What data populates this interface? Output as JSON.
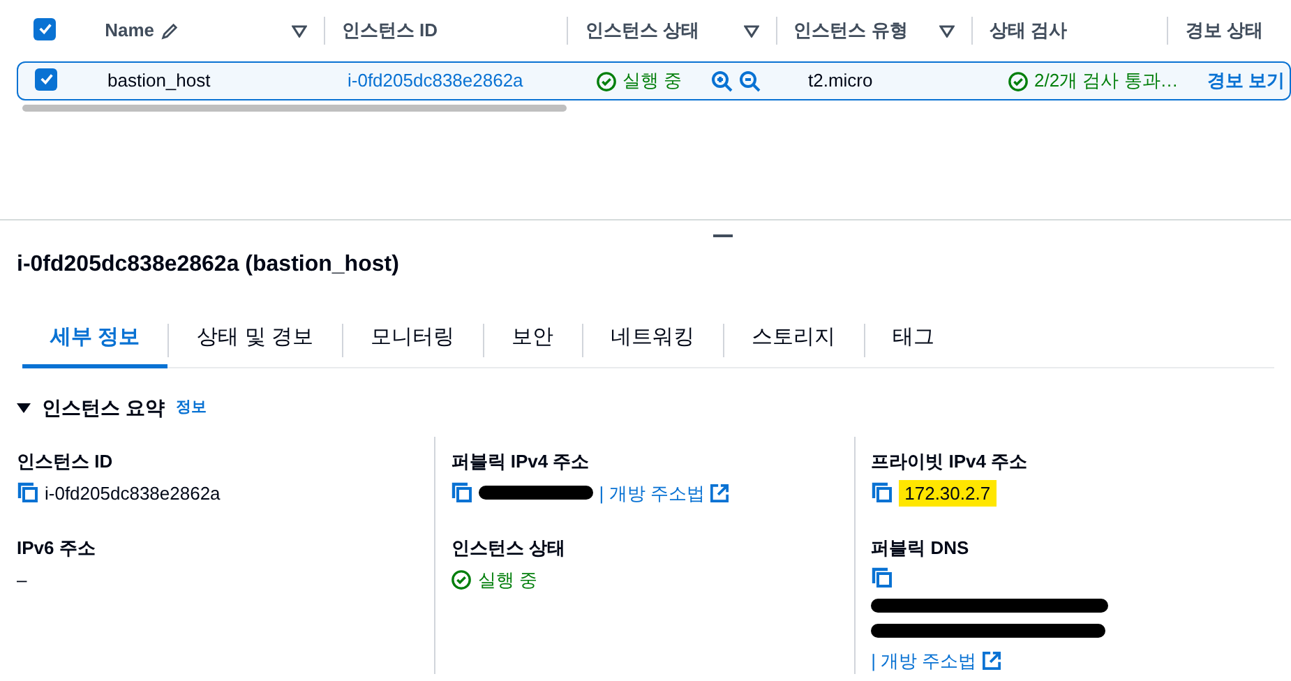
{
  "table": {
    "all_selected": true,
    "columns": [
      {
        "label": "Name",
        "editable": true,
        "filter": true
      },
      {
        "label": "인스턴스 ID",
        "editable": false,
        "filter": false
      },
      {
        "label": "인스턴스 상태",
        "editable": false,
        "filter": true
      },
      {
        "label": "인스턴스 유형",
        "editable": false,
        "filter": true
      },
      {
        "label": "상태 검사",
        "editable": false,
        "filter": false
      },
      {
        "label": "경보 상태",
        "editable": false,
        "filter": false
      }
    ],
    "rows": [
      {
        "selected": true,
        "name": "bastion_host",
        "instance_id": "i-0fd205dc838e2862a",
        "state": "실행 중",
        "type": "t2.micro",
        "check": "2/2개 검사 통과…",
        "alarm": "경보 보기"
      }
    ]
  },
  "detail": {
    "title": "i-0fd205dc838e2862a (bastion_host)",
    "tabs": [
      {
        "label": "세부 정보",
        "selected": true
      },
      {
        "label": "상태 및 경보",
        "selected": false
      },
      {
        "label": "모니터링",
        "selected": false
      },
      {
        "label": "보안",
        "selected": false
      },
      {
        "label": "네트워킹",
        "selected": false
      },
      {
        "label": "스토리지",
        "selected": false
      },
      {
        "label": "태그",
        "selected": false
      }
    ],
    "section": {
      "title": "인스턴스 요약",
      "expanded": true,
      "info": "정보"
    },
    "columns": [
      [
        {
          "label": "인스턴스 ID",
          "kind": "copy",
          "value": "i-0fd205dc838e2862a"
        },
        {
          "label": "IPv6 주소",
          "kind": "text",
          "value": "–"
        }
      ],
      [
        {
          "label": "퍼블릭 IPv4 주소",
          "kind": "redacted-link",
          "link": "| 개방 주소법"
        },
        {
          "label": "인스턴스 상태",
          "kind": "status",
          "value": "실행 중"
        }
      ],
      [
        {
          "label": "프라이빗 IPv4 주소",
          "kind": "highlight",
          "value": "172.30.2.7"
        },
        {
          "label": "퍼블릭 DNS",
          "kind": "redacted-dns",
          "link": "| 개방 주소법"
        }
      ]
    ]
  }
}
